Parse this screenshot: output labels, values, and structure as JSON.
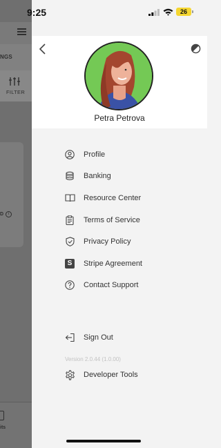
{
  "status_bar": {
    "time": "9:25",
    "battery": "26"
  },
  "background_app": {
    "tab_fragment": "NGS",
    "filter_label": "FILTER",
    "card_fragment": "D",
    "bottom_label_fragment": "its"
  },
  "drawer": {
    "user_name": "Petra Petrova",
    "menu_items": [
      {
        "label": "Profile",
        "icon": "user-icon"
      },
      {
        "label": "Banking",
        "icon": "database-icon"
      },
      {
        "label": "Resource Center",
        "icon": "book-icon"
      },
      {
        "label": "Terms of Service",
        "icon": "clipboard-icon"
      },
      {
        "label": "Privacy Policy",
        "icon": "shield-icon"
      },
      {
        "label": "Stripe Agreement",
        "icon": "stripe-logo-icon"
      },
      {
        "label": "Contact Support",
        "icon": "help-icon"
      }
    ],
    "sign_out_label": "Sign Out",
    "version": "Version 2.0.44 (1.0.00)",
    "developer_tools_label": "Developer Tools"
  },
  "colors": {
    "overlay": "#6f6f6f",
    "drawer_bg": "#f3f3f3",
    "header_bg": "#ffffff",
    "avatar_bg": "#74c955",
    "battery": "#f5d630"
  }
}
